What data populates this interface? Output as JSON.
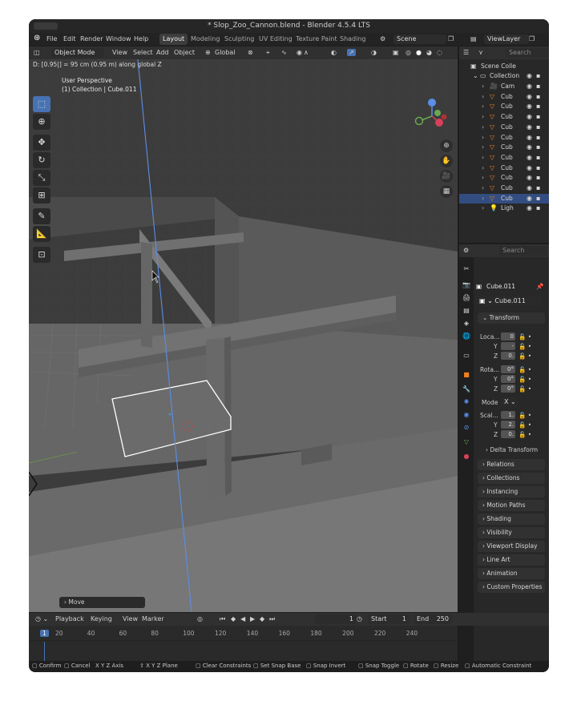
{
  "window": {
    "title": "* Slop_Zoo_Cannon.blend - Blender 4.5.4 LTS"
  },
  "menu": {
    "file": "File",
    "edit": "Edit",
    "render": "Render",
    "window": "Window",
    "help": "Help"
  },
  "workspaces": [
    "Layout",
    "Modeling",
    "Sculpting",
    "UV Editing",
    "Texture Paint",
    "Shading"
  ],
  "scene": {
    "name": "Scene",
    "view_layer": "ViewLayer"
  },
  "viewport": {
    "mode": "Object Mode",
    "menus": [
      "View",
      "Select",
      "Add",
      "Object"
    ],
    "orientation": "Global",
    "status": "D: [0.95|] = 95 cm (0.95 m) along global Z",
    "perspective": "User Perspective",
    "collection_info": "(1) Collection | Cube.011",
    "operator_panel": "Move"
  },
  "outliner": {
    "search_placeholder": "Search",
    "scene_collection": "Scene Colle",
    "collection": "Collection",
    "items": [
      {
        "label": "Cam",
        "type": "camera"
      },
      {
        "label": "Cub",
        "type": "mesh"
      },
      {
        "label": "Cub",
        "type": "mesh"
      },
      {
        "label": "Cub",
        "type": "mesh"
      },
      {
        "label": "Cub",
        "type": "mesh"
      },
      {
        "label": "Cub",
        "type": "mesh"
      },
      {
        "label": "Cub",
        "type": "mesh"
      },
      {
        "label": "Cub",
        "type": "mesh"
      },
      {
        "label": "Cub",
        "type": "mesh"
      },
      {
        "label": "Cub",
        "type": "mesh"
      },
      {
        "label": "Cub",
        "type": "mesh"
      },
      {
        "label": "Cub",
        "type": "mesh",
        "selected": true
      },
      {
        "label": "Ligh",
        "type": "light"
      }
    ]
  },
  "properties": {
    "search_placeholder": "Search",
    "object_name": "Cube.011",
    "data_name": "Cube.011",
    "transform_label": "Transform",
    "location_label": "Loca...",
    "location": [
      "0",
      "-",
      "0."
    ],
    "rotation_label": "Rota...",
    "rotation": [
      "0°",
      "0°",
      "0°"
    ],
    "mode_label": "Mode",
    "mode_value": "X",
    "scale_label": "Scal...",
    "scale": [
      "1.",
      "2.",
      "0."
    ],
    "axis_y": "Y",
    "axis_z": "Z",
    "delta": "Delta Transform",
    "panels": [
      "Relations",
      "Collections",
      "Instancing",
      "Motion Paths",
      "Shading",
      "Visibility",
      "Viewport Display",
      "Line Art",
      "Animation",
      "Custom Properties"
    ]
  },
  "timeline": {
    "menus": [
      "Playback",
      "Keying",
      "View",
      "Marker"
    ],
    "current_frame": "1",
    "start_label": "Start",
    "start": "1",
    "end_label": "End",
    "end": "250",
    "ticks": [
      "1",
      "20",
      "40",
      "60",
      "80",
      "100",
      "120",
      "140",
      "160",
      "180",
      "200",
      "220",
      "240"
    ]
  },
  "statusbar": [
    "Confirm",
    "Cancel",
    "X Y Z Axis",
    "X Y Z Plane",
    "Clear Constraints",
    "Set Snap Base",
    "Snap Invert",
    "Snap Toggle",
    "Rotate",
    "Resize",
    "Automatic Constraint"
  ],
  "colors": {
    "accent": "#4772b3",
    "selection": "#ffffff",
    "z_axis_line": "#5b8ee6"
  }
}
